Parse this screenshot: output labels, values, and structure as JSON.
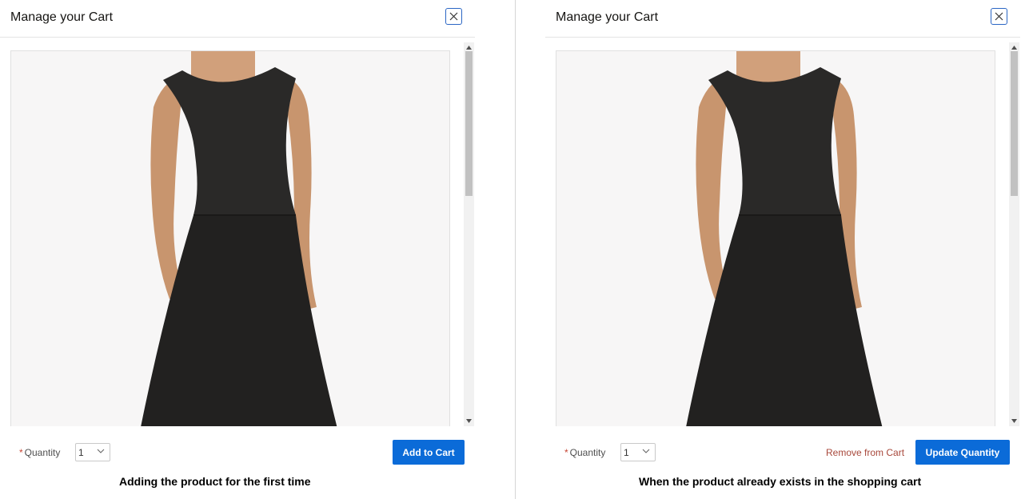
{
  "left_panel": {
    "title": "Manage your Cart",
    "quantity_label": "Quantity",
    "quantity_required_marker": "*",
    "quantity_value": "1",
    "primary_button": "Add to Cart",
    "caption": "Adding the product for the first time"
  },
  "right_panel": {
    "title": "Manage your Cart",
    "quantity_label": "Quantity",
    "quantity_required_marker": "*",
    "quantity_value": "1",
    "secondary_link": "Remove from Cart",
    "primary_button": "Update Quantity",
    "caption": "When the product already exists in the shopping cart"
  },
  "icons": {
    "close": "close-icon",
    "chevron": "chevron-down-icon",
    "scroll_up": "scroll-up-arrow-icon",
    "scroll_down": "scroll-down-arrow-icon"
  },
  "colors": {
    "primary_button": "#0b6bd8",
    "remove_link": "#a8483b",
    "required": "#c74634",
    "close_border": "#2b66c4"
  }
}
